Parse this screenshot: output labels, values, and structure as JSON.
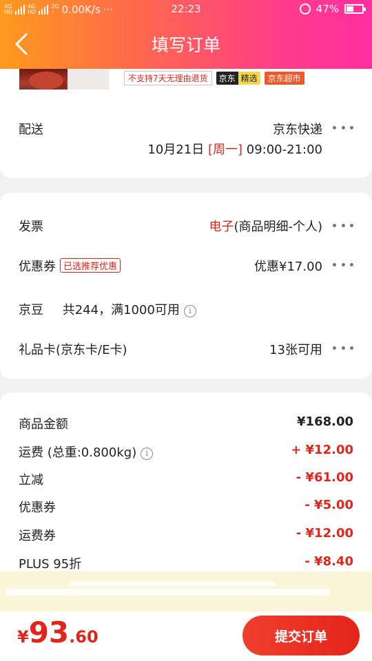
{
  "status": {
    "network": "0.00K/s",
    "dots": "···",
    "time": "22:23",
    "battery": "47%",
    "battery_level": 0.47
  },
  "nav": {
    "title": "填写订单"
  },
  "product": {
    "tags": {
      "no_return": "不支持7天无理由退货",
      "jd": "京东",
      "jd_select": "精选",
      "jd_super": "京东超市"
    }
  },
  "delivery": {
    "label": "配送",
    "method": "京东快递",
    "date": "10月21日",
    "weekday": "[周一]",
    "time": "09:00-21:00"
  },
  "invoice": {
    "label": "发票",
    "type": "电子",
    "detail": "(商品明细-个人)"
  },
  "coupon": {
    "label": "优惠券",
    "badge": "已选推荐优惠",
    "value": "优惠¥17.00"
  },
  "jingdou": {
    "label": "京豆",
    "text": "共244，满1000可用"
  },
  "giftcard": {
    "label": "礼品卡(京东卡/E卡)",
    "value": "13张可用"
  },
  "summary": [
    {
      "label": "商品金额",
      "value": "¥168.00",
      "red": false
    },
    {
      "label": "运费 (总重:0.800kg)",
      "value": "+ ¥12.00",
      "red": true,
      "info": true
    },
    {
      "label": "立减",
      "value": "- ¥61.00",
      "red": true
    },
    {
      "label": "优惠券",
      "value": "- ¥5.00",
      "red": true
    },
    {
      "label": "运费券",
      "value": "- ¥12.00",
      "red": true
    },
    {
      "label": "PLUS 95折",
      "value": "- ¥8.40",
      "red": true
    }
  ],
  "total": {
    "currency": "¥",
    "integer": "93",
    "decimal": ".60"
  },
  "submit": {
    "label": "提交订单"
  },
  "colors": {
    "accent": "#e1251b",
    "header_start": "#ff9a1e",
    "header_end": "#ff2fa0"
  }
}
